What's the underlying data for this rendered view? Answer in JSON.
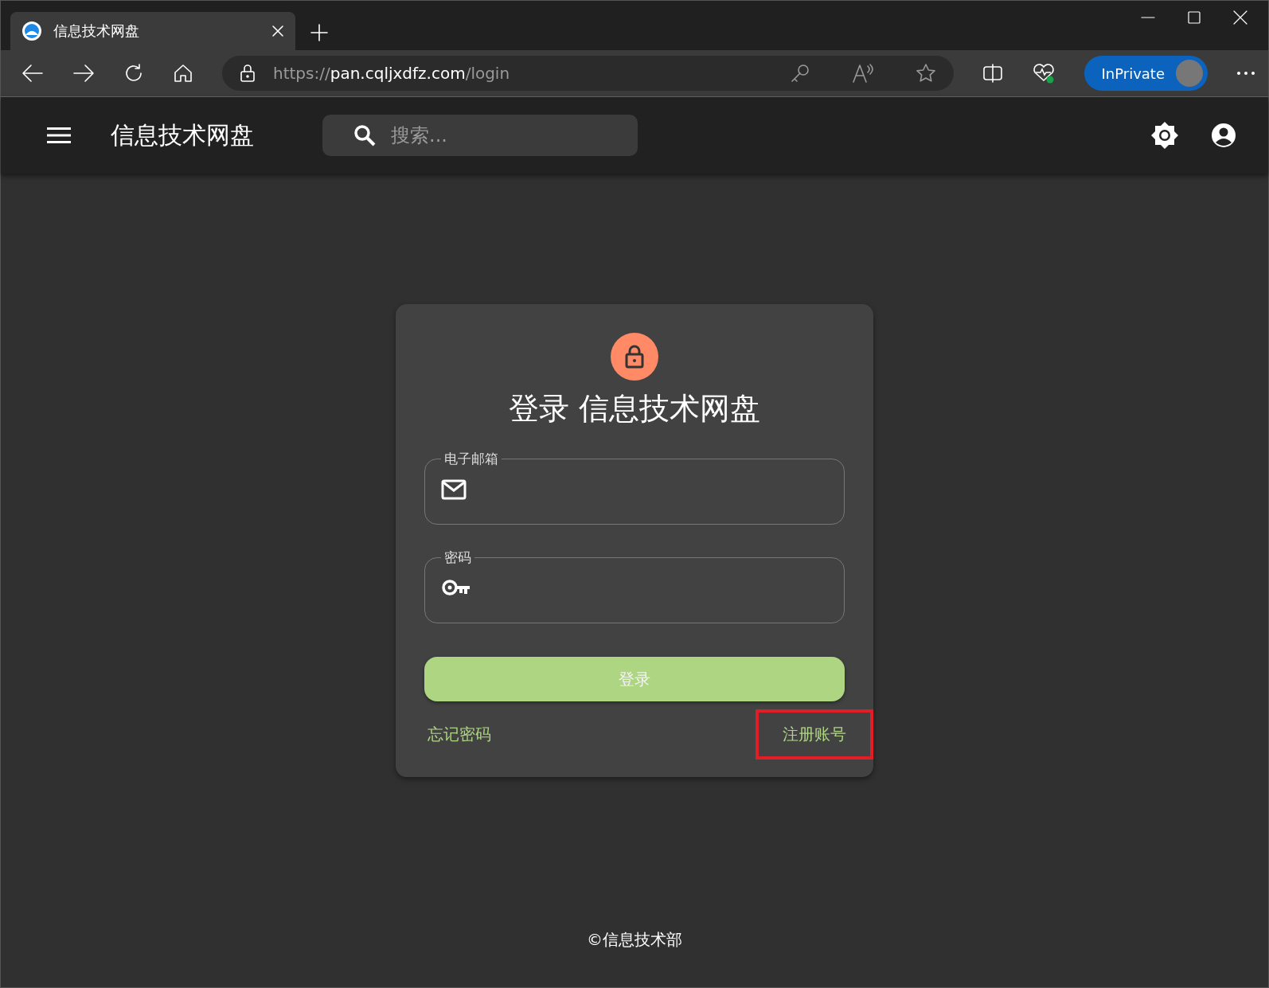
{
  "browser": {
    "tab": {
      "title": "信息技术网盘",
      "selected": true
    },
    "address": {
      "scheme": "https://",
      "host": "pan.cqljxdfz.com",
      "path": "/login"
    },
    "profile": {
      "label": "InPrivate"
    }
  },
  "app_bar": {
    "title": "信息技术网盘",
    "search": {
      "placeholder": "搜索..."
    }
  },
  "login": {
    "title": "登录 信息技术网盘",
    "fields": [
      {
        "kind": "email",
        "label": "电子邮箱"
      },
      {
        "kind": "password",
        "label": "密码"
      }
    ],
    "submit": "登录",
    "links": [
      {
        "label": "忘记密码",
        "highlighted": false
      },
      {
        "label": "注册账号",
        "highlighted": true
      }
    ]
  },
  "footer": "©信息技术部"
}
